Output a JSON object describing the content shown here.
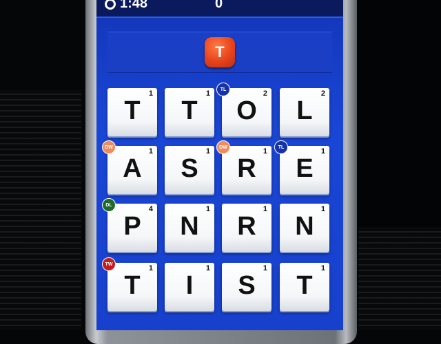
{
  "status": {
    "timer": "1:48",
    "score": "0"
  },
  "current_word": {
    "letter": "T"
  },
  "board": [
    [
      {
        "letter": "T",
        "points": "1",
        "bonus": ""
      },
      {
        "letter": "T",
        "points": "1",
        "bonus": ""
      },
      {
        "letter": "O",
        "points": "2",
        "bonus": "TL"
      },
      {
        "letter": "L",
        "points": "2",
        "bonus": ""
      }
    ],
    [
      {
        "letter": "A",
        "points": "1",
        "bonus": "DW"
      },
      {
        "letter": "S",
        "points": "1",
        "bonus": ""
      },
      {
        "letter": "R",
        "points": "1",
        "bonus": "DW"
      },
      {
        "letter": "E",
        "points": "1",
        "bonus": "TL"
      }
    ],
    [
      {
        "letter": "P",
        "points": "4",
        "bonus": "DL"
      },
      {
        "letter": "N",
        "points": "1",
        "bonus": ""
      },
      {
        "letter": "R",
        "points": "1",
        "bonus": ""
      },
      {
        "letter": "N",
        "points": "1",
        "bonus": ""
      }
    ],
    [
      {
        "letter": "T",
        "points": "1",
        "bonus": "TW"
      },
      {
        "letter": "I",
        "points": "1",
        "bonus": ""
      },
      {
        "letter": "S",
        "points": "1",
        "bonus": ""
      },
      {
        "letter": "T",
        "points": "1",
        "bonus": ""
      }
    ]
  ],
  "bonus_colors": {
    "TL": "#1532a8",
    "DW": "#f08a5a",
    "DL": "#1e6a2a",
    "TW": "#c41a1a"
  }
}
